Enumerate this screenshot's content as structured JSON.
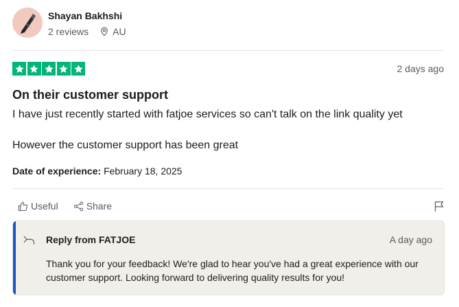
{
  "reviewer": {
    "name": "Shayan Bakhshi",
    "reviews_count": "2 reviews",
    "location": "AU"
  },
  "rating": {
    "stars": 5,
    "max": 5,
    "date": "2 days ago",
    "color": "#00b67a"
  },
  "review": {
    "title": "On their customer support",
    "body_p1": "I have just recently started with fatjoe services so can't talk on the link quality yet",
    "body_p2": "However the customer support has been great",
    "experience_label": "Date of experience:",
    "experience_date": "February 18, 2025"
  },
  "actions": {
    "useful_label": "Useful",
    "share_label": "Share"
  },
  "reply": {
    "title": "Reply from FATJOE",
    "date": "A day ago",
    "text": "Thank you for your feedback! We're glad to hear you've had a great experience with our customer support. Looking forward to delivering quality results for you!",
    "accent_color": "#1a56c8"
  },
  "icons": {
    "location": "location-pin-icon",
    "useful": "thumbs-up-icon",
    "share": "share-icon",
    "flag": "flag-icon",
    "reply": "reply-arrow-icon",
    "star": "star-icon"
  }
}
